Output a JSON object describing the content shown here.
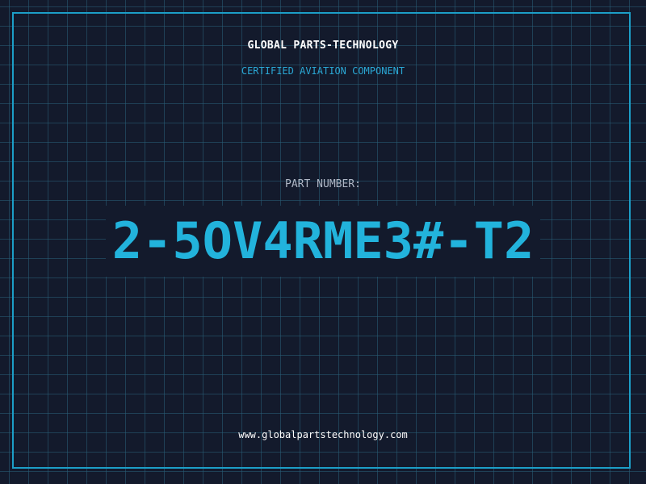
{
  "header": {
    "company_name": "GLOBAL PARTS-TECHNOLOGY",
    "subtitle": "CERTIFIED AVIATION COMPONENT"
  },
  "main": {
    "label": "PART NUMBER:",
    "part_number": "2-5OV4RME3#-T2"
  },
  "footer": {
    "url": "www.globalpartstechnology.com"
  },
  "colors": {
    "background": "#131a2c",
    "grid": "#285f78",
    "accent": "#22b3dc",
    "frame": "#1c9ec7",
    "text": "#ffffff",
    "label": "#aeb6c5"
  }
}
